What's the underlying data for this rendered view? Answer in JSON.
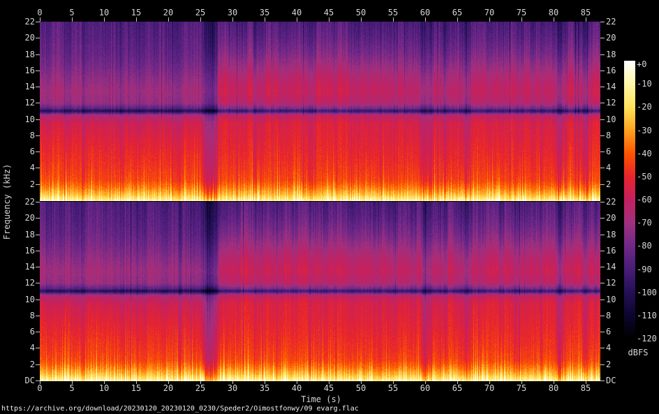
{
  "page": {
    "background": "#000000",
    "text_color": "#d6d6d6",
    "url_text": "https://archive.org/download/20230120_20230120_0230/Speder2/Oimostfonwy/09 evarg.flac"
  },
  "chart_data": {
    "type": "heatmap",
    "subtype": "stereo-audio-spectrogram",
    "title": "",
    "xlabel": "Time (s)",
    "ylabel": "Frequency (kHz)",
    "channels": 2,
    "duration_s": 87.3,
    "time_ticks_s": [
      0,
      5,
      10,
      15,
      20,
      25,
      30,
      35,
      40,
      45,
      50,
      55,
      60,
      65,
      70,
      75,
      80,
      85
    ],
    "freq_ticks_khz": [
      22,
      20,
      18,
      16,
      14,
      12,
      10,
      8,
      6,
      4,
      2
    ],
    "dc_label": "DC",
    "freq_range_khz": [
      0,
      22
    ],
    "grid": false,
    "colorbar": {
      "label": "dBFS",
      "tick_labels": [
        "+0",
        "-10",
        "-20",
        "-30",
        "-40",
        "-50",
        "-60",
        "-70",
        "-80",
        "-90",
        "-100",
        "-110",
        "-120"
      ],
      "range_db": [
        0,
        -120
      ],
      "position": "right",
      "palette_stops": [
        {
          "db": 0,
          "color": "#ffffff"
        },
        {
          "db": -10,
          "color": "#fff7a8"
        },
        {
          "db": -20,
          "color": "#ffe25a"
        },
        {
          "db": -30,
          "color": "#ffa21e"
        },
        {
          "db": -40,
          "color": "#fc5500"
        },
        {
          "db": -50,
          "color": "#e8242c"
        },
        {
          "db": -60,
          "color": "#c42060"
        },
        {
          "db": -70,
          "color": "#a0307e"
        },
        {
          "db": -80,
          "color": "#702888"
        },
        {
          "db": -90,
          "color": "#481c78"
        },
        {
          "db": -100,
          "color": "#241055"
        },
        {
          "db": -110,
          "color": "#0d0530"
        },
        {
          "db": -120,
          "color": "#000000"
        }
      ]
    },
    "spectral_profile_db": [
      [
        0,
        -15
      ],
      [
        0.3,
        -20
      ],
      [
        0.8,
        -28
      ],
      [
        1.5,
        -36
      ],
      [
        2.5,
        -44
      ],
      [
        4,
        -47
      ],
      [
        6,
        -50
      ],
      [
        8,
        -53
      ],
      [
        9.5,
        -55
      ],
      [
        10.5,
        -62
      ],
      [
        10.85,
        -85
      ],
      [
        11.05,
        -97
      ],
      [
        11.35,
        -80
      ],
      [
        12,
        -66
      ],
      [
        13.5,
        -62
      ],
      [
        15,
        -66
      ],
      [
        16.5,
        -72
      ],
      [
        18,
        -78
      ],
      [
        20,
        -84
      ],
      [
        22,
        -88
      ]
    ],
    "hf_sections": [
      {
        "t0": 0,
        "t1": 25.5,
        "gain_db": -8
      },
      {
        "t0": 25.5,
        "t1": 27.8,
        "gain_db": -4
      },
      {
        "t0": 27.8,
        "t1": 55,
        "gain_db": 4
      },
      {
        "t0": 55,
        "t1": 70,
        "gain_db": 1
      },
      {
        "t0": 70,
        "t1": 87.3,
        "gain_db": 3
      }
    ],
    "quiet_events": [
      {
        "t": 6.8,
        "w": 0.2,
        "db": -6
      },
      {
        "t": 12.9,
        "w": 0.2,
        "db": -6
      },
      {
        "t": 21.8,
        "w": 0.25,
        "db": -7
      },
      {
        "t": 25.9,
        "w": 0.45,
        "db": -14
      },
      {
        "t": 26.9,
        "w": 0.5,
        "db": -16
      },
      {
        "t": 33.5,
        "w": 0.2,
        "db": -5
      },
      {
        "t": 42.0,
        "w": 0.2,
        "db": -5
      },
      {
        "t": 46.0,
        "w": 0.2,
        "db": -6
      },
      {
        "t": 53.0,
        "w": 0.2,
        "db": -5
      },
      {
        "t": 59.8,
        "w": 0.4,
        "db": -10
      },
      {
        "t": 60.8,
        "w": 0.3,
        "db": -8
      },
      {
        "t": 63.0,
        "w": 0.2,
        "db": -6
      },
      {
        "t": 66.5,
        "w": 0.3,
        "db": -8
      },
      {
        "t": 74.0,
        "w": 0.2,
        "db": -5
      },
      {
        "t": 78.0,
        "w": 0.2,
        "db": -5
      },
      {
        "t": 80.9,
        "w": 0.35,
        "db": -14
      },
      {
        "t": 84.9,
        "w": 0.3,
        "db": -10
      }
    ]
  }
}
